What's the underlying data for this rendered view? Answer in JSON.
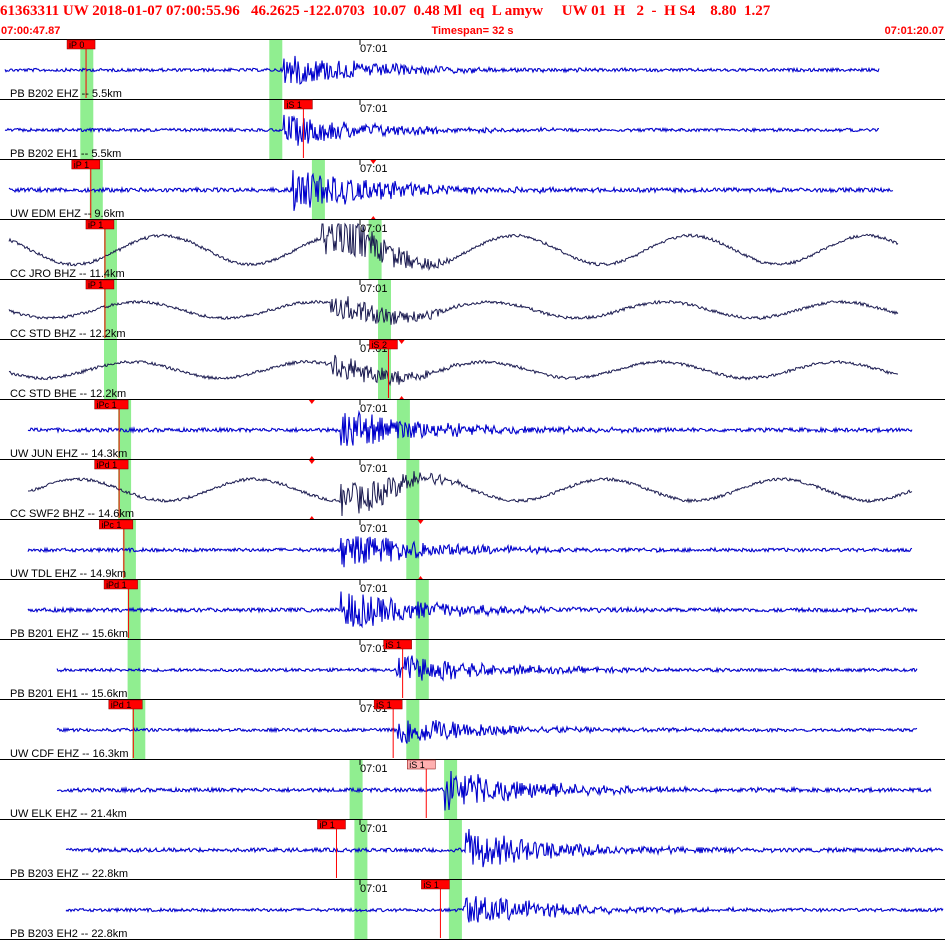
{
  "header": {
    "event_line": "61363311 UW 2018-01-07 07:00:55.96   46.2625 -122.0703  10.07  0.48 Ml  eq  L amyw     UW 01  H   2  -  H S4    8.80  1.27",
    "start_time": "07:00:47.87",
    "timespan": "Timespan=  32 s",
    "end_time": "07:01:20.07"
  },
  "time_tick_label": "07:01",
  "colors": {
    "header_text": "#ff0000",
    "trace_high_freq": "#0000cc",
    "trace_broadband": "#1a1a50",
    "pick_flag": "#ff0000",
    "pick_flag_light": "#ffb0b0",
    "pick_window": "#90ee90",
    "pick_line": "#ff0000",
    "separator": "#000000"
  },
  "traces": [
    {
      "label": "PB B202 EHZ -- 5.5km",
      "style": "hf",
      "amp": 0.9,
      "p_window": 0.085,
      "s_window": 0.285,
      "picks": [
        {
          "label": "iP 0",
          "kind": "P",
          "pos": 0.09
        }
      ],
      "onset": 0.3,
      "marker": null,
      "start": 0.005,
      "end": 0.93
    },
    {
      "label": "PB B202 EH1 -- 5.5km",
      "style": "hf",
      "amp": 0.9,
      "p_window": 0.085,
      "s_window": 0.285,
      "picks": [
        {
          "label": "iS 1",
          "kind": "S",
          "pos": 0.32
        }
      ],
      "onset": 0.3,
      "marker": null,
      "start": 0.005,
      "end": 0.93
    },
    {
      "label": "UW EDM EHZ -- 9.6km",
      "style": "hf",
      "amp": 1.2,
      "p_window": 0.095,
      "s_window": 0.33,
      "picks": [
        {
          "label": "iP 1",
          "kind": "P",
          "pos": 0.095
        }
      ],
      "onset": 0.31,
      "marker": 0.395,
      "start": 0.01,
      "end": 0.945
    },
    {
      "label": "CC JRO BHZ -- 11.4km",
      "style": "lf",
      "amp": 1.6,
      "p_window": 0.11,
      "s_window": 0.39,
      "picks": [
        {
          "label": "iP 1",
          "kind": "P",
          "pos": 0.11
        }
      ],
      "onset": 0.34,
      "marker": null,
      "start": 0.01,
      "end": 0.95
    },
    {
      "label": "CC STD BHZ -- 12.2km",
      "style": "lf",
      "amp": 0.9,
      "p_window": 0.11,
      "s_window": 0.4,
      "picks": [
        {
          "label": "iP 1",
          "kind": "P",
          "pos": 0.11
        }
      ],
      "onset": 0.35,
      "marker": null,
      "start": 0.01,
      "end": 0.95
    },
    {
      "label": "CC STD BHE -- 12.2km",
      "style": "lf",
      "amp": 0.9,
      "p_window": 0.11,
      "s_window": 0.4,
      "picks": [
        {
          "label": "iS 2",
          "kind": "S",
          "pos": 0.41
        }
      ],
      "onset": 0.35,
      "marker": 0.425,
      "start": 0.01,
      "end": 0.95
    },
    {
      "label": "UW JUN EHZ -- 14.3km",
      "style": "hf",
      "amp": 1.1,
      "p_window": 0.125,
      "s_window": 0.42,
      "picks": [
        {
          "label": "iPc 1",
          "kind": "P",
          "pos": 0.125
        }
      ],
      "onset": 0.36,
      "marker": 0.33,
      "start": 0.03,
      "end": 0.965
    },
    {
      "label": "CC SWF2 BHZ -- 14.6km",
      "style": "lf",
      "amp": 1.2,
      "p_window": 0.125,
      "s_window": 0.43,
      "picks": [
        {
          "label": "iPd 1",
          "kind": "P",
          "pos": 0.125
        }
      ],
      "onset": 0.36,
      "marker": 0.33,
      "start": 0.03,
      "end": 0.965
    },
    {
      "label": "UW TDL EHZ -- 14.9km",
      "style": "hf",
      "amp": 1.0,
      "p_window": 0.13,
      "s_window": 0.43,
      "picks": [
        {
          "label": "iPc 1",
          "kind": "P",
          "pos": 0.13
        }
      ],
      "onset": 0.36,
      "marker": 0.445,
      "start": 0.03,
      "end": 0.965
    },
    {
      "label": "PB B201 EHZ -- 15.6km",
      "style": "hf",
      "amp": 1.1,
      "p_window": 0.135,
      "s_window": 0.44,
      "picks": [
        {
          "label": "iPd 1",
          "kind": "P",
          "pos": 0.135
        }
      ],
      "onset": 0.36,
      "marker": null,
      "start": 0.03,
      "end": 0.97
    },
    {
      "label": "PB B201 EH1 -- 15.6km",
      "style": "hf",
      "amp": 0.9,
      "p_window": 0.135,
      "s_window": 0.44,
      "picks": [
        {
          "label": "iS 1",
          "kind": "S",
          "pos": 0.425
        }
      ],
      "onset": 0.42,
      "marker": null,
      "start": 0.06,
      "end": 0.97
    },
    {
      "label": "UW CDF EHZ -- 16.3km",
      "style": "hf",
      "amp": 0.9,
      "p_window": 0.14,
      "s_window": 0.43,
      "picks": [
        {
          "label": "iPd 1",
          "kind": "P",
          "pos": 0.14
        },
        {
          "label": "iS 1",
          "kind": "S",
          "pos": 0.415
        }
      ],
      "onset": 0.42,
      "marker": null,
      "start": 0.06,
      "end": 0.97
    },
    {
      "label": "UW ELK EHZ -- 21.4km",
      "style": "hf",
      "amp": 1.1,
      "p_window": 0.37,
      "s_window": 0.47,
      "picks": [
        {
          "label": "iS 1",
          "kind": "S_light",
          "pos": 0.45
        }
      ],
      "onset": 0.47,
      "marker": null,
      "start": 0.06,
      "end": 0.985
    },
    {
      "label": "PB B203 EHZ -- 22.8km",
      "style": "hf",
      "amp": 1.1,
      "p_window": 0.375,
      "s_window": 0.475,
      "picks": [
        {
          "label": "iP 1",
          "kind": "P",
          "pos": 0.355
        }
      ],
      "onset": 0.49,
      "marker": null,
      "start": 0.07,
      "end": 0.998
    },
    {
      "label": "PB B203 EH2 -- 22.8km",
      "style": "hf",
      "amp": 0.9,
      "p_window": 0.375,
      "s_window": 0.475,
      "picks": [
        {
          "label": "iS 1",
          "kind": "S",
          "pos": 0.465
        }
      ],
      "onset": 0.49,
      "marker": null,
      "start": 0.07,
      "end": 0.998
    }
  ]
}
